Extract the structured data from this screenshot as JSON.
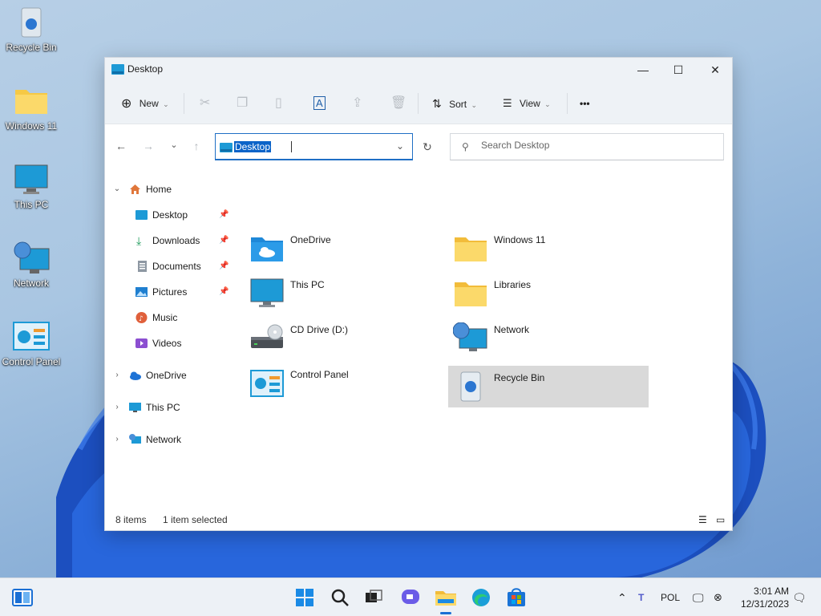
{
  "desktop": {
    "icons": [
      {
        "label": "Recycle Bin",
        "icon": "recycle-bin-icon"
      },
      {
        "label": "Windows 11",
        "icon": "folder-icon"
      },
      {
        "label": "This PC",
        "icon": "monitor-icon"
      },
      {
        "label": "Network",
        "icon": "network-icon"
      },
      {
        "label": "Control Panel",
        "icon": "control-panel-icon"
      }
    ]
  },
  "window": {
    "title": "Desktop",
    "controls": {
      "minimize": "—",
      "maximize": "☐",
      "close": "✕"
    },
    "toolbar": {
      "new_label": "New",
      "sort_label": "Sort",
      "view_label": "View",
      "more_label": "•••"
    },
    "address": {
      "value": "Desktop"
    },
    "search": {
      "placeholder": "Search Desktop"
    },
    "nav": {
      "home": "Home",
      "quick_access": [
        {
          "label": "Desktop",
          "icon": "desktop-icon"
        },
        {
          "label": "Downloads",
          "icon": "download-icon"
        },
        {
          "label": "Documents",
          "icon": "documents-icon"
        },
        {
          "label": "Pictures",
          "icon": "pictures-icon"
        },
        {
          "label": "Music",
          "icon": "music-icon"
        },
        {
          "label": "Videos",
          "icon": "videos-icon"
        }
      ],
      "onedrive": "OneDrive",
      "this_pc": "This PC",
      "network": "Network"
    },
    "files": [
      {
        "name": "OneDrive",
        "icon": "onedrive-folder-icon"
      },
      {
        "name": "Windows 11",
        "icon": "folder-icon"
      },
      {
        "name": "This PC",
        "icon": "monitor-icon"
      },
      {
        "name": "Libraries",
        "icon": "folder-icon"
      },
      {
        "name": "CD Drive (D:)",
        "icon": "cd-drive-icon"
      },
      {
        "name": "Network",
        "icon": "network-icon"
      },
      {
        "name": "Control Panel",
        "icon": "control-panel-icon"
      },
      {
        "name": "Recycle Bin",
        "icon": "recycle-bin-icon",
        "selected": true
      }
    ],
    "status": {
      "items": "8 items",
      "selected": "1 item selected"
    }
  },
  "taskbar": {
    "language": "POL",
    "time": "3:01 AM",
    "date": "12/31/2023"
  },
  "colors": {
    "accent": "#0b63c8",
    "selection": "#d9d9d9",
    "folder": "#f6c945"
  }
}
